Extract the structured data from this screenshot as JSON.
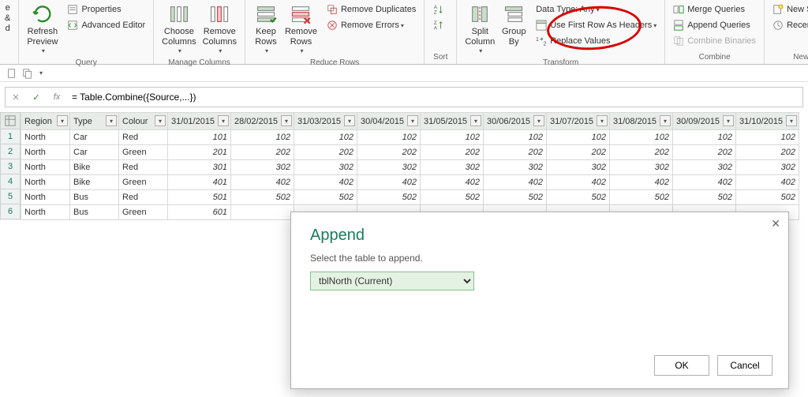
{
  "ribbon": {
    "close_paste": {
      "line1": "e &",
      "line2": "d"
    },
    "query": {
      "refresh": "Refresh\nPreview",
      "properties": "Properties",
      "advanced_editor": "Advanced Editor",
      "label": "Query"
    },
    "manage_cols": {
      "choose": "Choose\nColumns",
      "remove": "Remove\nColumns",
      "label": "Manage Columns"
    },
    "reduce_rows": {
      "keep": "Keep\nRows",
      "remove": "Remove\nRows",
      "remove_dup": "Remove Duplicates",
      "remove_err": "Remove Errors",
      "label": "Reduce Rows"
    },
    "sort": {
      "label": "Sort"
    },
    "transform": {
      "split": "Split\nColumn",
      "groupby": "Group\nBy",
      "datatype": "Data Type: Any",
      "first_row": "Use First Row As Headers",
      "replace": "Replace Values",
      "label": "Transform"
    },
    "combine": {
      "merge": "Merge Queries",
      "append": "Append Queries",
      "binaries": "Combine Binaries",
      "label": "Combine"
    },
    "new_query": {
      "new_source": "New Source",
      "recent": "Recent Sources",
      "label": "New Query"
    }
  },
  "formula": "= Table.Combine({Source,...})",
  "columns": [
    "Region",
    "Type",
    "Colour",
    "31/01/2015",
    "28/02/2015",
    "31/03/2015",
    "30/04/2015",
    "31/05/2015",
    "30/06/2015",
    "31/07/2015",
    "31/08/2015",
    "30/09/2015",
    "31/10/2015"
  ],
  "rows": [
    {
      "n": 1,
      "region": "North",
      "type": "Car",
      "colour": "Red",
      "vals": [
        101,
        102,
        102,
        102,
        102,
        102,
        102,
        102,
        102,
        102
      ]
    },
    {
      "n": 2,
      "region": "North",
      "type": "Car",
      "colour": "Green",
      "vals": [
        201,
        202,
        202,
        202,
        202,
        202,
        202,
        202,
        202,
        202
      ]
    },
    {
      "n": 3,
      "region": "North",
      "type": "Bike",
      "colour": "Red",
      "vals": [
        301,
        302,
        302,
        302,
        302,
        302,
        302,
        302,
        302,
        302
      ]
    },
    {
      "n": 4,
      "region": "North",
      "type": "Bike",
      "colour": "Green",
      "vals": [
        401,
        402,
        402,
        402,
        402,
        402,
        402,
        402,
        402,
        402
      ]
    },
    {
      "n": 5,
      "region": "North",
      "type": "Bus",
      "colour": "Red",
      "vals": [
        501,
        502,
        502,
        502,
        502,
        502,
        502,
        502,
        502,
        502
      ]
    },
    {
      "n": 6,
      "region": "North",
      "type": "Bus",
      "colour": "Green",
      "vals": [
        601,
        null,
        null,
        null,
        null,
        null,
        null,
        null,
        null,
        null
      ]
    }
  ],
  "dialog": {
    "title": "Append",
    "instruction": "Select the table to append.",
    "selected": "tblNorth (Current)",
    "ok": "OK",
    "cancel": "Cancel"
  }
}
